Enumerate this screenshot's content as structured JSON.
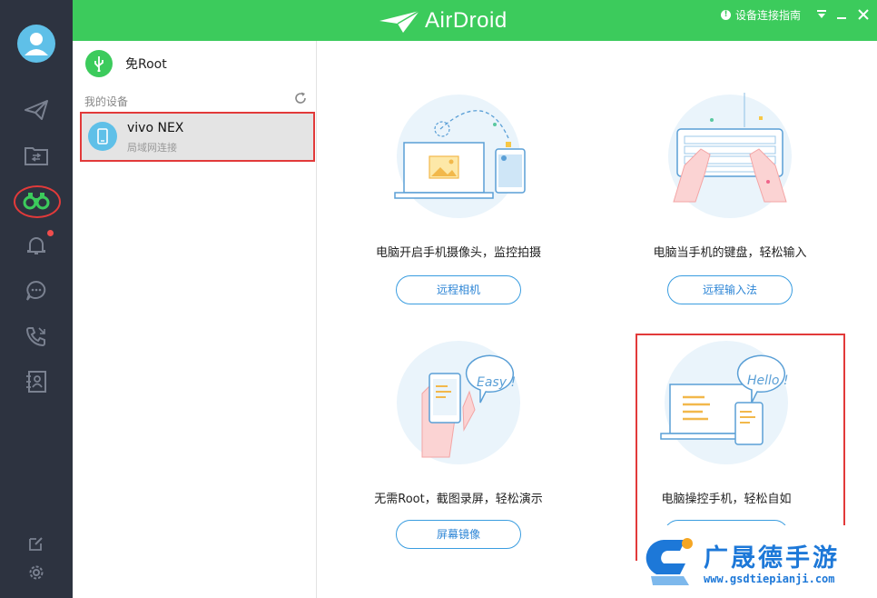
{
  "app": {
    "title": "AirDroid"
  },
  "topbar": {
    "guide_label": "设备连接指南",
    "info_glyph": "!"
  },
  "device_panel": {
    "no_root_label": "免Root",
    "my_devices_label": "我的设备",
    "devices": [
      {
        "name": "vivo NEX",
        "status": "局域网连接"
      }
    ]
  },
  "features": [
    {
      "desc": "电脑开启手机摄像头，监控拍摄",
      "button": "远程相机"
    },
    {
      "desc": "电脑当手机的键盘，轻松输入",
      "button": "远程输入法"
    },
    {
      "desc": "无需Root，截图录屏，轻松演示",
      "button": "屏幕镜像"
    },
    {
      "desc": "电脑操控手机，轻松自如",
      "button": ""
    }
  ],
  "illustration_text": {
    "easy": "Easy !",
    "hello": "Hello !"
  },
  "watermark": {
    "title": "广晟德手游",
    "url": "www.gsdtiepianji.com"
  },
  "colors": {
    "accent_green": "#3ccb5c",
    "rail_bg": "#2d3340",
    "link_blue": "#2e86d6",
    "highlight_red": "#e23a3a"
  },
  "icons": [
    "user-avatar-icon",
    "send-icon",
    "folder-transfer-icon",
    "binoculars-icon",
    "bell-icon",
    "chat-icon",
    "phone-icon",
    "contacts-icon",
    "edit-icon",
    "settings-icon",
    "usb-icon",
    "refresh-icon",
    "phone-device-icon"
  ]
}
